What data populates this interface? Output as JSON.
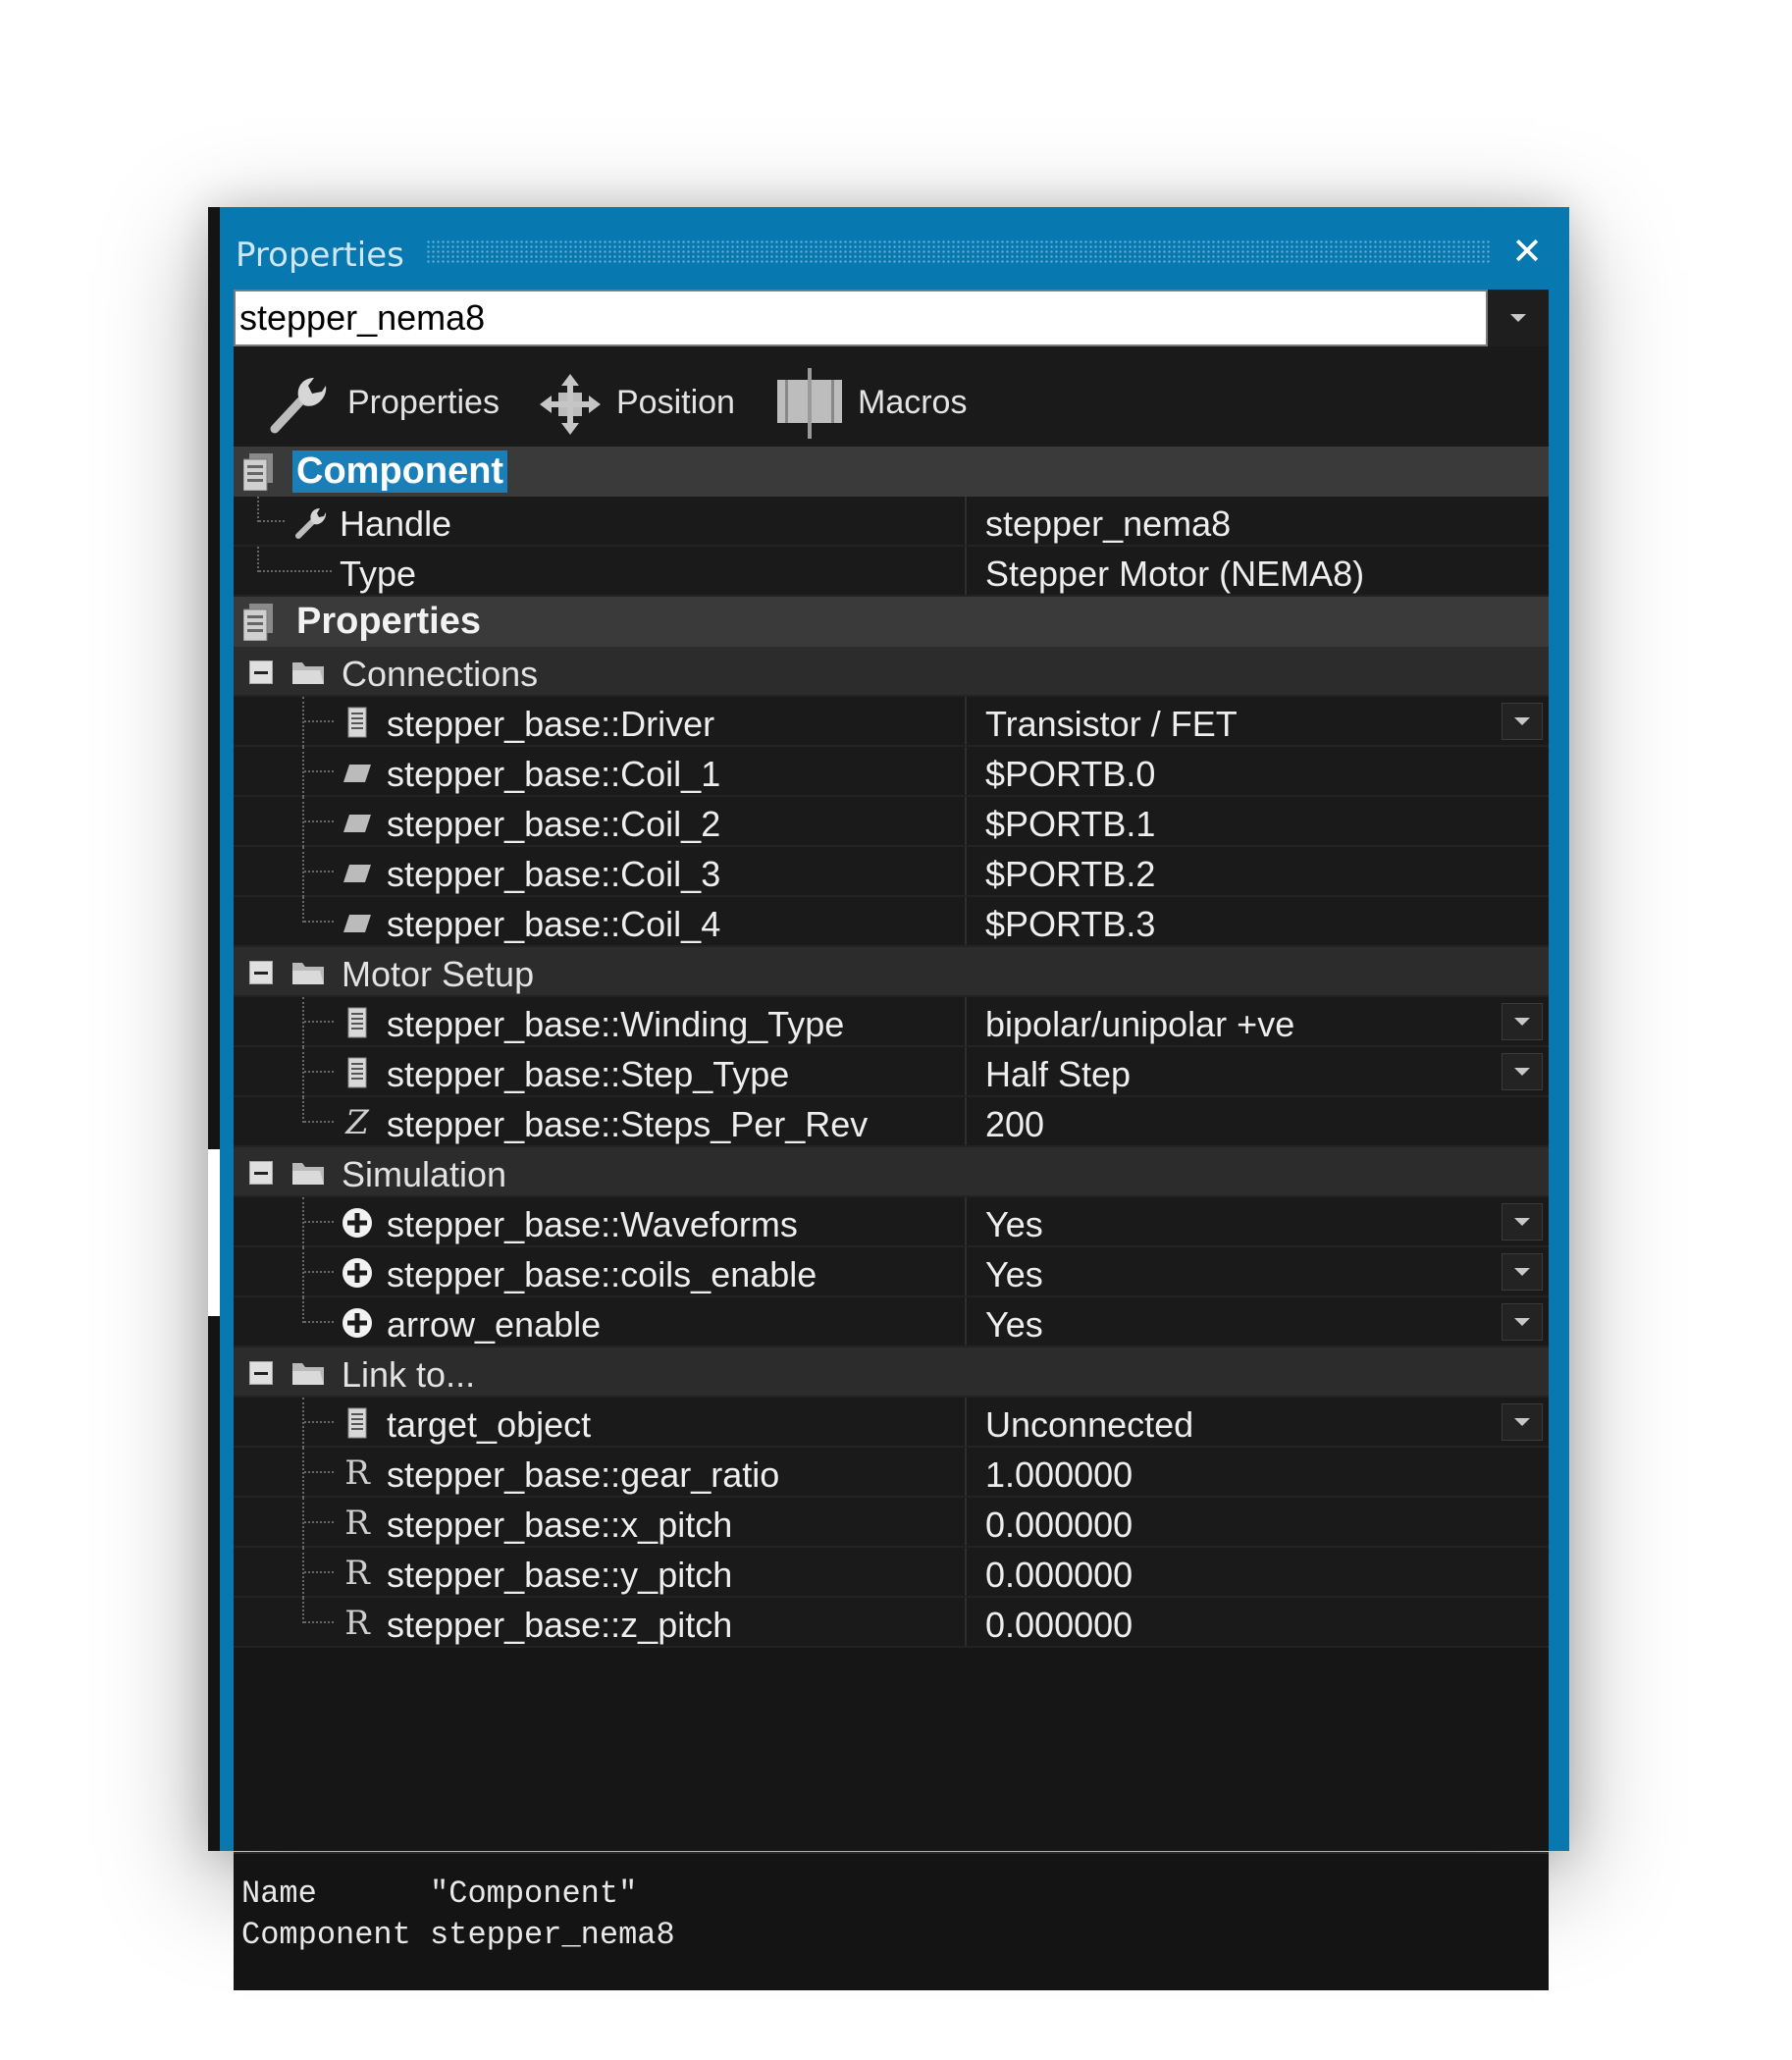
{
  "window": {
    "title": "Properties",
    "close_symbol": "✕"
  },
  "selector": {
    "value": "stepper_nema8"
  },
  "tabs": [
    {
      "label": "Properties",
      "icon": "wrench-icon"
    },
    {
      "label": "Position",
      "icon": "move-arrows-icon"
    },
    {
      "label": "Macros",
      "icon": "macros-icon"
    }
  ],
  "categories": {
    "component": {
      "label": "Component",
      "handle": {
        "name": "Handle",
        "value": "stepper_nema8"
      },
      "type": {
        "name": "Type",
        "value": "Stepper Motor (NEMA8)"
      }
    },
    "properties": {
      "label": "Properties"
    }
  },
  "groups": {
    "connections": {
      "label": "Connections",
      "rows": [
        {
          "name": "stepper_base::Driver",
          "value": "Transistor / FET",
          "icon": "list-icon"
        },
        {
          "name": "stepper_base::Coil_1",
          "value": "$PORTB.0",
          "icon": "pin-icon"
        },
        {
          "name": "stepper_base::Coil_2",
          "value": "$PORTB.1",
          "icon": "pin-icon"
        },
        {
          "name": "stepper_base::Coil_3",
          "value": "$PORTB.2",
          "icon": "pin-icon"
        },
        {
          "name": "stepper_base::Coil_4",
          "value": "$PORTB.3",
          "icon": "pin-icon"
        }
      ]
    },
    "motor_setup": {
      "label": "Motor Setup",
      "rows": [
        {
          "name": "stepper_base::Winding_Type",
          "value": "bipolar/unipolar +ve",
          "icon": "list-icon"
        },
        {
          "name": "stepper_base::Step_Type",
          "value": "Half Step",
          "icon": "list-icon"
        },
        {
          "name": "stepper_base::Steps_Per_Rev",
          "value": "200",
          "icon": "integer-icon"
        }
      ]
    },
    "simulation": {
      "label": "Simulation",
      "rows": [
        {
          "name": "stepper_base::Waveforms",
          "value": "Yes",
          "icon": "plus-circle-icon"
        },
        {
          "name": "stepper_base::coils_enable",
          "value": "Yes",
          "icon": "plus-circle-icon"
        },
        {
          "name": "arrow_enable",
          "value": "Yes",
          "icon": "plus-circle-icon"
        }
      ]
    },
    "link_to": {
      "label": "Link to...",
      "rows": [
        {
          "name": "target_object",
          "value": "Unconnected",
          "icon": "list-icon"
        },
        {
          "name": "stepper_base::gear_ratio",
          "value": "1.000000",
          "icon": "real-icon"
        },
        {
          "name": "stepper_base::x_pitch",
          "value": "0.000000",
          "icon": "real-icon"
        },
        {
          "name": "stepper_base::y_pitch",
          "value": "0.000000",
          "icon": "real-icon"
        },
        {
          "name": "stepper_base::z_pitch",
          "value": "0.000000",
          "icon": "real-icon"
        }
      ]
    }
  },
  "footer": {
    "line1": "Name      \"Component\"",
    "line2": "Component stepper_nema8"
  },
  "icon_glyphs": {
    "integer": "Z",
    "real": "R"
  },
  "colors": {
    "title_bar": "#0879b0",
    "selection": "#1a7fb8",
    "panel_bg": "#161616"
  }
}
